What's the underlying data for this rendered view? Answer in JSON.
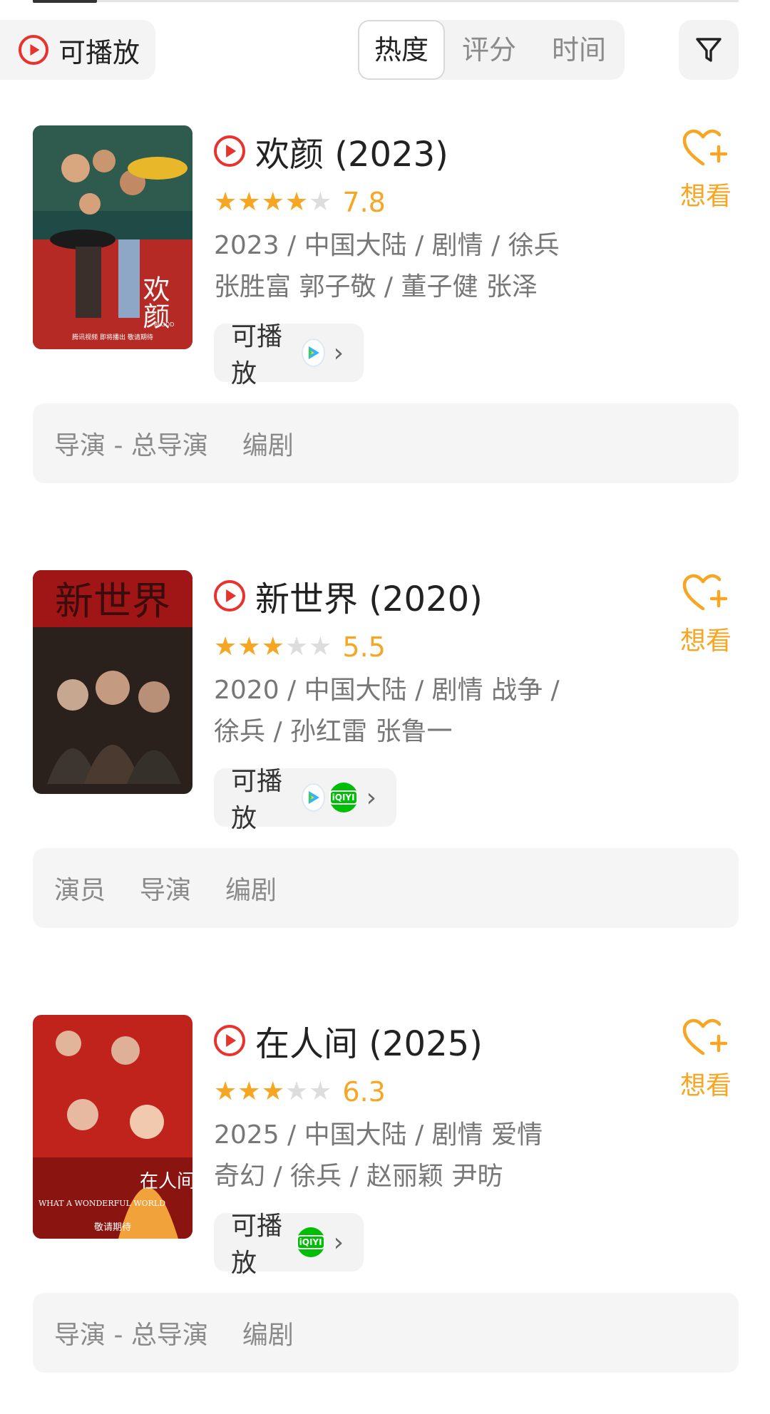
{
  "filter": {
    "playable_label": "可播放"
  },
  "sort": {
    "tabs": [
      "热度",
      "评分",
      "时间"
    ],
    "active": "热度"
  },
  "movies": [
    {
      "title": "欢颜 (2023)",
      "stars": 4,
      "score": "7.8",
      "meta": [
        "2023 / 中国大陆 / 剧情 / 徐兵",
        "张胜富 郭子敬 / 董子健 张泽"
      ],
      "play_label": "可播放",
      "platforms": [
        "tencent-video"
      ],
      "want_label": "想看",
      "crew": [
        "导演 - 总导演",
        "编剧"
      ],
      "poster": {
        "title_art": "欢颜",
        "subtitle_art": "BLOOD",
        "caption": "腾讯视频 即将播出 敬请期待",
        "colors": [
          "#1f4a45",
          "#b52a25"
        ]
      }
    },
    {
      "title": "新世界 (2020)",
      "stars": 3,
      "score": "5.5",
      "meta": [
        "2020 / 中国大陆 / 剧情 战争 /",
        "徐兵 / 孙红雷 张鲁一"
      ],
      "play_label": "可播放",
      "platforms": [
        "tencent-video",
        "iqiyi"
      ],
      "want_label": "想看",
      "crew": [
        "演员",
        "导演",
        "编剧"
      ],
      "poster": {
        "title_art": "新世界",
        "colors": [
          "#2a201c",
          "#a01515"
        ]
      }
    },
    {
      "title": "在人间 (2025)",
      "stars": 3,
      "score": "6.3",
      "meta": [
        "2025 / 中国大陆 / 剧情 爱情",
        "奇幻 / 徐兵 / 赵丽颖 尹昉"
      ],
      "play_label": "可播放",
      "platforms": [
        "iqiyi"
      ],
      "want_label": "想看",
      "crew": [
        "导演 - 总导演",
        "编剧"
      ],
      "poster": {
        "title_art": "在人间",
        "english_art": "WHAT A WONDERFUL WORLD",
        "caption": "敬请期待",
        "colors": [
          "#c0221c",
          "#f2a23a"
        ]
      }
    }
  ],
  "colors": {
    "accent_play": "#e8322e",
    "star": "#f6a623",
    "want": "#f6a623"
  }
}
